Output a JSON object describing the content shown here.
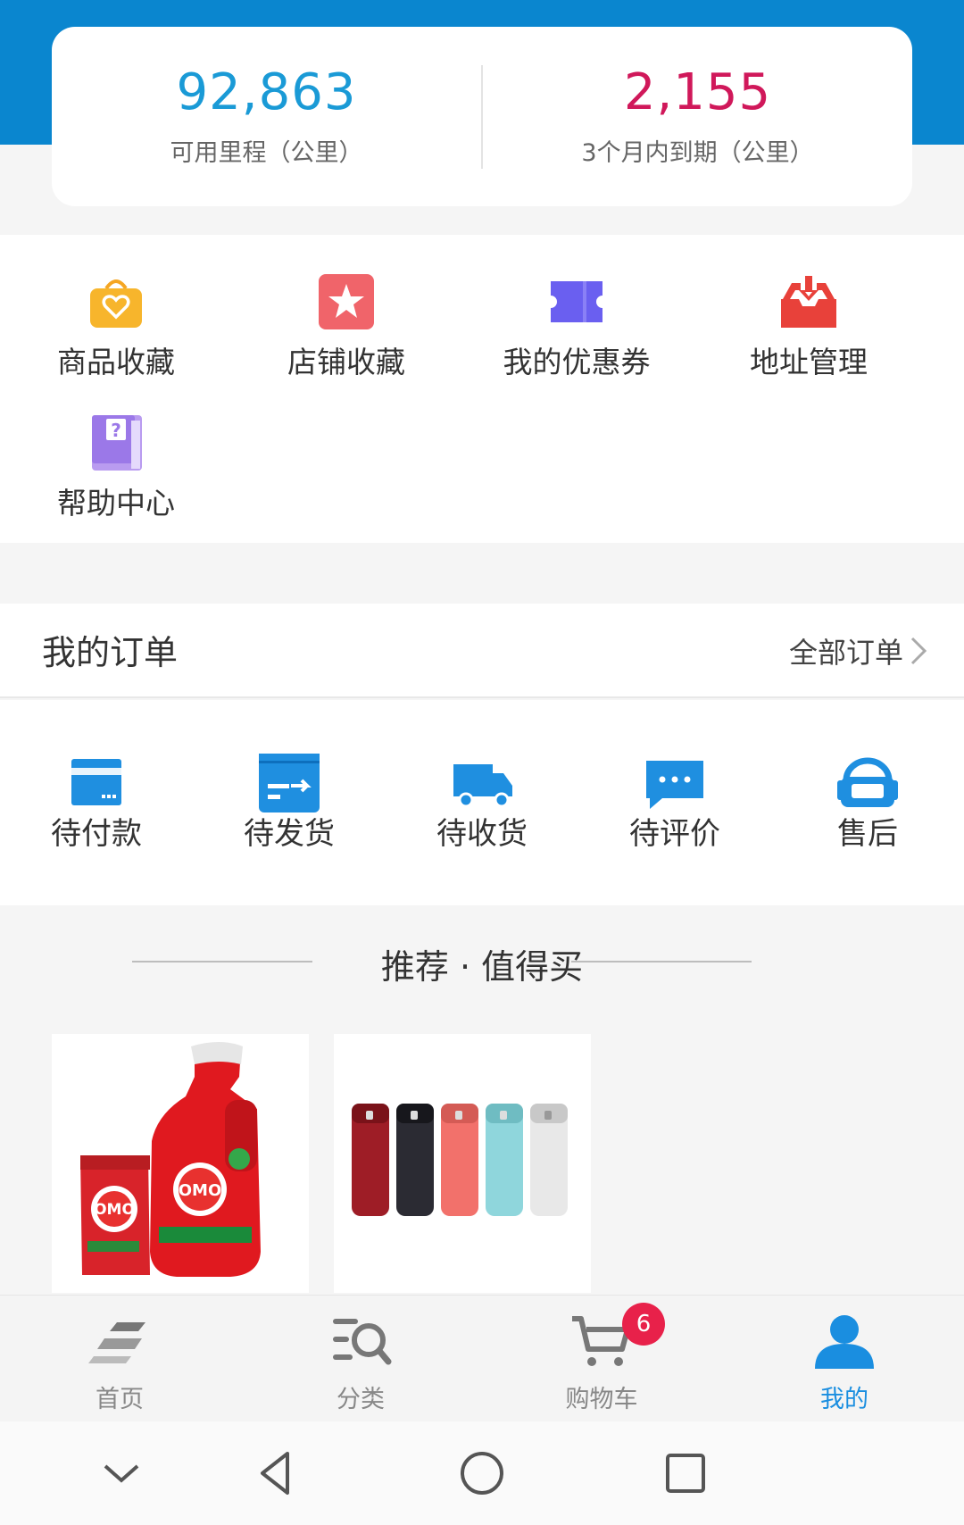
{
  "stats": {
    "available": {
      "value": "92,863",
      "label": "可用里程（公里）"
    },
    "expiring": {
      "value": "2,155",
      "label": "3个月内到期（公里）"
    }
  },
  "tools": [
    {
      "label": "商品收藏",
      "icon": "shopping-bag-heart-icon"
    },
    {
      "label": "店铺收藏",
      "icon": "star-shop-icon"
    },
    {
      "label": "我的优惠券",
      "icon": "coupon-ticket-icon"
    },
    {
      "label": "地址管理",
      "icon": "address-inbox-icon"
    },
    {
      "label": "帮助中心",
      "icon": "help-book-icon"
    }
  ],
  "orders": {
    "title": "我的订单",
    "all_label": "全部订单",
    "statuses": [
      {
        "label": "待付款",
        "icon": "card-payment-icon"
      },
      {
        "label": "待发货",
        "icon": "box-shipping-icon"
      },
      {
        "label": "待收货",
        "icon": "truck-icon"
      },
      {
        "label": "待评价",
        "icon": "chat-bubble-icon"
      },
      {
        "label": "售后",
        "icon": "after-sale-icon"
      }
    ]
  },
  "recommend": {
    "title": "推荐 · 值得买",
    "products": [
      {
        "image_text": "OMO"
      },
      {
        "image_text": ""
      }
    ]
  },
  "tabbar": {
    "tabs": [
      {
        "label": "首页",
        "icon": "home-stripes-icon"
      },
      {
        "label": "分类",
        "icon": "category-search-icon"
      },
      {
        "label": "购物车",
        "icon": "cart-icon",
        "badge": "6"
      },
      {
        "label": "我的",
        "icon": "user-icon"
      }
    ],
    "active_index": 3
  },
  "colors": {
    "header_blue": "#0a86cf",
    "stat_blue": "#1a9ad6",
    "stat_red": "#d0185a",
    "active_tab": "#1a8ee0",
    "badge_red": "#e8214a"
  }
}
